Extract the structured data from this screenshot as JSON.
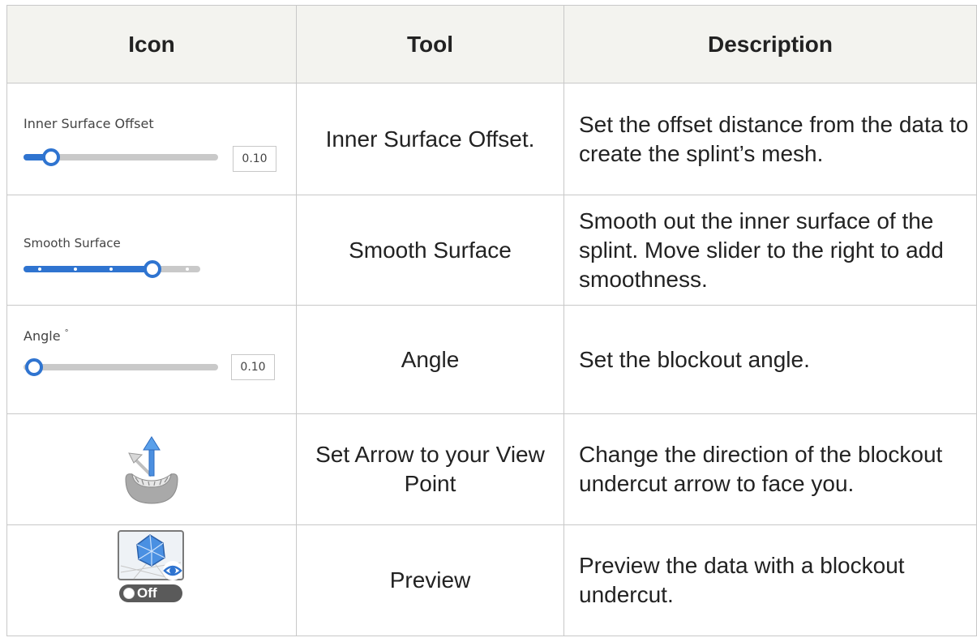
{
  "header": {
    "icon": "Icon",
    "tool": "Tool",
    "description": "Description"
  },
  "rows": [
    {
      "slider_label": "Inner Surface Offset",
      "slider_value": "0.10",
      "slider_level": 0.1,
      "tool": "Inner Surface Offset.",
      "description": "Set the offset distance from the data to create the splint’s mesh."
    },
    {
      "slider_label": "Smooth Surface",
      "slider_level": 0.7,
      "tool": "Smooth Surface",
      "description": "Smooth out the inner surface of the splint. Move slider to the right to add smoothness."
    },
    {
      "slider_label": "Angle",
      "slider_label_suffix": "°",
      "slider_value": "0.10",
      "slider_level": 0.0,
      "tool": "Angle",
      "description": "Set the blockout angle."
    },
    {
      "icon": "set-arrow-view-point-icon",
      "tool": "Set Arrow to your View Point",
      "description": "Change the direction of the blockout undercut arrow to face you."
    },
    {
      "icon": "preview-icon",
      "toggle_label": "Off",
      "tool": "Preview",
      "description": "Preview the data with a blockout undercut."
    }
  ],
  "colors": {
    "accent": "#2f74d0",
    "header_bg": "#f3f3ef",
    "border": "#c8c8c8"
  }
}
